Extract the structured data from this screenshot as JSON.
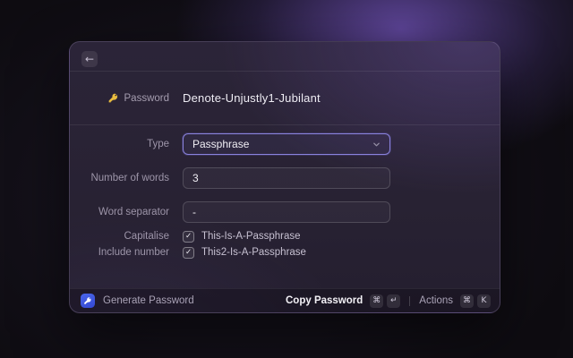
{
  "back": {
    "glyph": "←"
  },
  "header": {
    "icon": "key-icon",
    "label": "Password",
    "value": "Denote-Unjustly1-Jubilant"
  },
  "form": {
    "type": {
      "label": "Type",
      "value": "Passphrase",
      "control": "dropdown",
      "focused": true
    },
    "words": {
      "label": "Number of words",
      "value": "3",
      "control": "text-input"
    },
    "separator": {
      "label": "Word separator",
      "value": "-",
      "control": "text-input"
    },
    "capitalise": {
      "label": "Capitalise",
      "text": "This-Is-A-Passphrase",
      "checked": true,
      "check_glyph": "✓"
    },
    "include_number": {
      "label": "Include number",
      "text": "This2-Is-A-Passphrase",
      "checked": true,
      "check_glyph": "✓"
    }
  },
  "footer": {
    "app_label": "Generate Password",
    "copy": {
      "label": "Copy Password",
      "keys": [
        "⌘",
        "↵"
      ]
    },
    "actions": {
      "label": "Actions",
      "keys": [
        "⌘",
        "K"
      ]
    }
  },
  "colors": {
    "background_glow": "#6d50b4",
    "window_top": "#2b2438",
    "window_bottom": "#241e2f",
    "focused_field_border": "#8a83dd",
    "key_icon_gold": "#e9bc3f",
    "app_icon_blue": "#3f55e0",
    "value_text": "#eeecf3",
    "label_text": "#9d95a9"
  }
}
